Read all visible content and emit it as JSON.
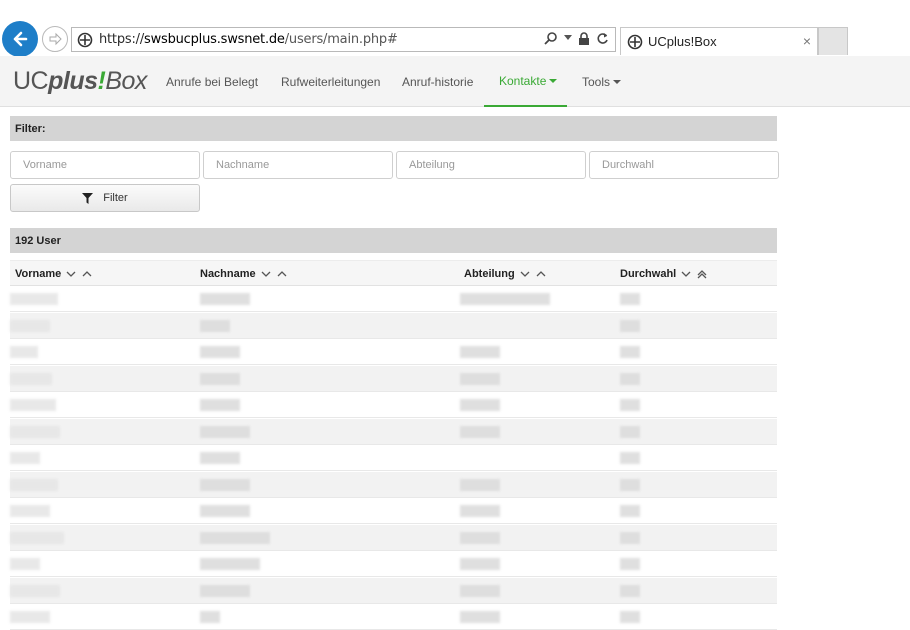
{
  "browser": {
    "url_prefix": "https://",
    "url_domain": "swsbucplus.swsnet.de",
    "url_path": "/users/main.php#",
    "tab_title": "UCplus!Box",
    "tab_close": "×"
  },
  "app": {
    "logo_uc": "UC",
    "logo_plus": "plus",
    "logo_bang": "!",
    "logo_box": "Box",
    "nav": [
      {
        "label": "Anrufe bei Belegt"
      },
      {
        "label": "Rufweiterleitungen"
      },
      {
        "label": "Anruf-historie"
      },
      {
        "label": "Kontakte",
        "active": true
      },
      {
        "label": "Tools"
      }
    ],
    "accent_color": "#3aa935"
  },
  "filter": {
    "heading": "Filter:",
    "placeholders": [
      "Vorname",
      "Nachname",
      "Abteilung",
      "Durchwahl"
    ],
    "button_label": "Filter"
  },
  "table": {
    "count_label": "192 User",
    "columns": [
      "Vorname",
      "Nachname",
      "Abteilung",
      "Durchwahl"
    ]
  }
}
